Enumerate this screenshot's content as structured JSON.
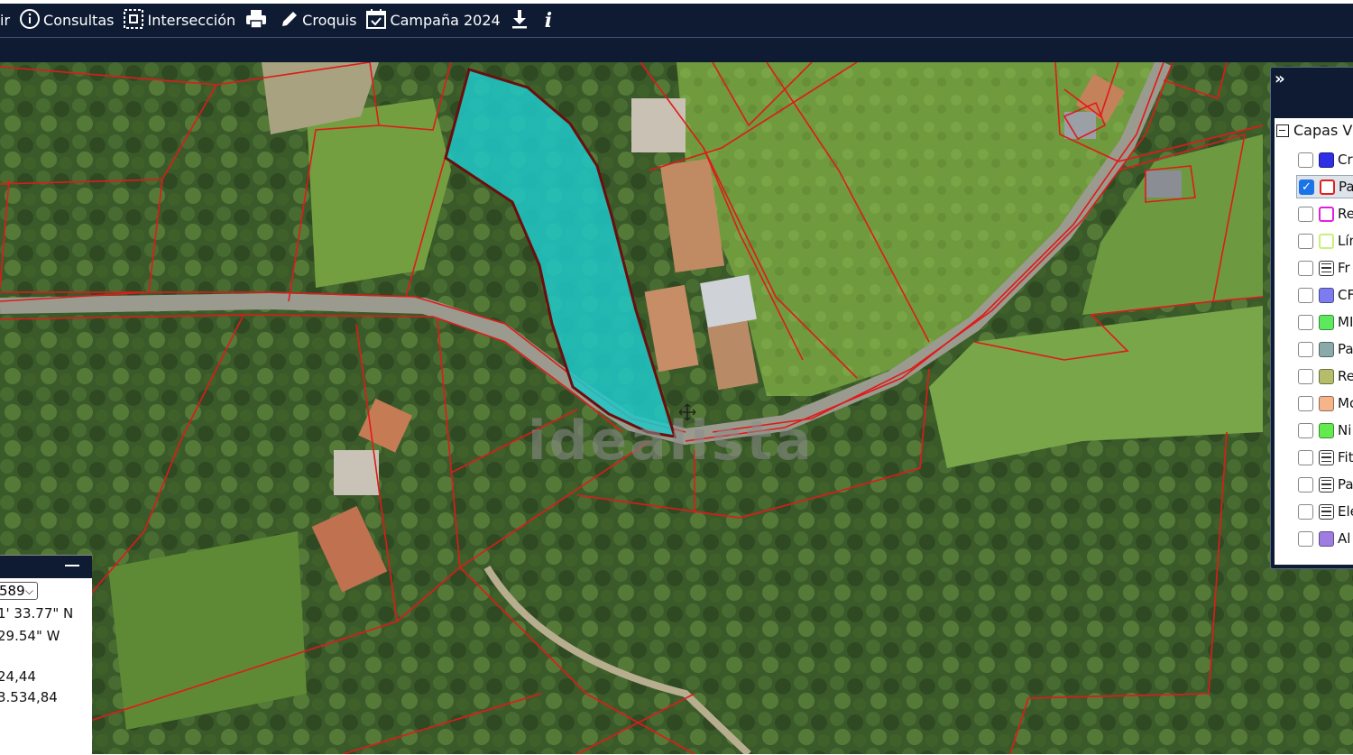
{
  "toolbar": {
    "items": [
      {
        "label": "ir",
        "icon": "none"
      },
      {
        "label": "Consultas",
        "icon": "info-circle-icon"
      },
      {
        "label": "Intersección",
        "icon": "intersection-icon"
      },
      {
        "label": "",
        "icon": "print-icon"
      },
      {
        "label": "Croquis",
        "icon": "pencil-icon"
      },
      {
        "label": "Campaña 2024",
        "icon": "calendar-check-icon"
      },
      {
        "label": "",
        "icon": "download-icon"
      },
      {
        "label": "",
        "icon": "info-italic-icon"
      }
    ],
    "bg_color": "#0e1b33"
  },
  "coordinates": {
    "srs_select_value": "589",
    "lat": "1' 33.77\" N",
    "lon": "29.54\" W",
    "x": "24,44",
    "y": "3.534,84"
  },
  "layers": {
    "group_label": "Capas V",
    "items": [
      {
        "label": "Cr",
        "checked": false,
        "swatch": "#2f2fe6",
        "type": "fill"
      },
      {
        "label": "Pa",
        "checked": true,
        "swatch": "#e02020",
        "type": "outline",
        "selected": true
      },
      {
        "label": "Re",
        "checked": false,
        "swatch": "#e020e0",
        "type": "outline"
      },
      {
        "label": "Lín",
        "checked": false,
        "swatch": "#c8f07a",
        "type": "outline"
      },
      {
        "label": "Fr",
        "checked": false,
        "swatch": "",
        "type": "list"
      },
      {
        "label": "CF",
        "checked": false,
        "swatch": "#7c7cf0",
        "type": "fill"
      },
      {
        "label": "MI",
        "checked": false,
        "swatch": "#5ee85e",
        "type": "fill"
      },
      {
        "label": "Pa",
        "checked": false,
        "swatch": "#8aa9a9",
        "type": "fill"
      },
      {
        "label": "Re",
        "checked": false,
        "swatch": "#b5bd6a",
        "type": "fill"
      },
      {
        "label": "Mc",
        "checked": false,
        "swatch": "#f5b48a",
        "type": "fill"
      },
      {
        "label": "Ni",
        "checked": false,
        "swatch": "#63ea4f",
        "type": "fill"
      },
      {
        "label": "Fit",
        "checked": false,
        "swatch": "",
        "type": "list"
      },
      {
        "label": "Pa",
        "checked": false,
        "swatch": "",
        "type": "list"
      },
      {
        "label": "Ele",
        "checked": false,
        "swatch": "",
        "type": "list"
      },
      {
        "label": "Al",
        "checked": false,
        "swatch": "#9f7de0",
        "type": "fill"
      }
    ]
  },
  "map": {
    "watermark": "idealista",
    "highlight_color": "#1ec8c8",
    "parcel_line_color": "#e01a1a"
  }
}
